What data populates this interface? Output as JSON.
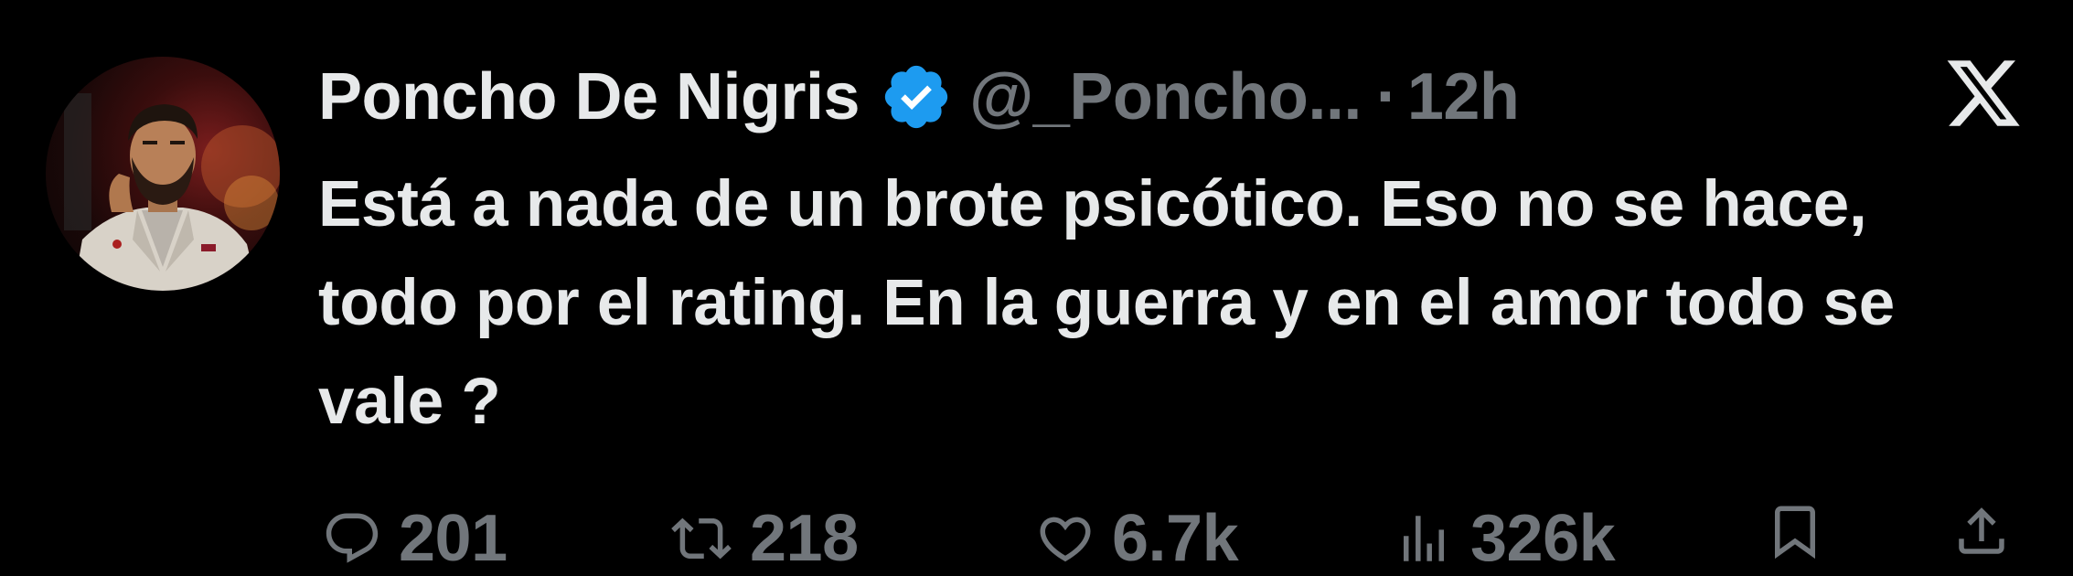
{
  "tweet": {
    "author": {
      "display_name": "Poncho De Nigris",
      "handle": "@_Poncho...",
      "verified": true,
      "avatar_icon": "profile-photo"
    },
    "separator": "·",
    "time": "12h",
    "text": "Está a nada de un brote psicótico. Eso no se hace, todo por el rating. En la guerra y en el amor todo se vale ?",
    "actions": {
      "replies": "201",
      "reposts": "218",
      "likes": "6.7k",
      "views": "326k"
    }
  },
  "colors": {
    "background": "#000000",
    "primary_text": "#e7e9ea",
    "secondary_text": "#71767b",
    "verified_badge": "#1d9bf0"
  },
  "icons": {
    "verified": "verified-badge-icon",
    "brand": "x-logo-icon",
    "reply": "reply-icon",
    "repost": "repost-icon",
    "like": "heart-icon",
    "views": "views-icon",
    "bookmark": "bookmark-icon",
    "share": "share-icon"
  }
}
